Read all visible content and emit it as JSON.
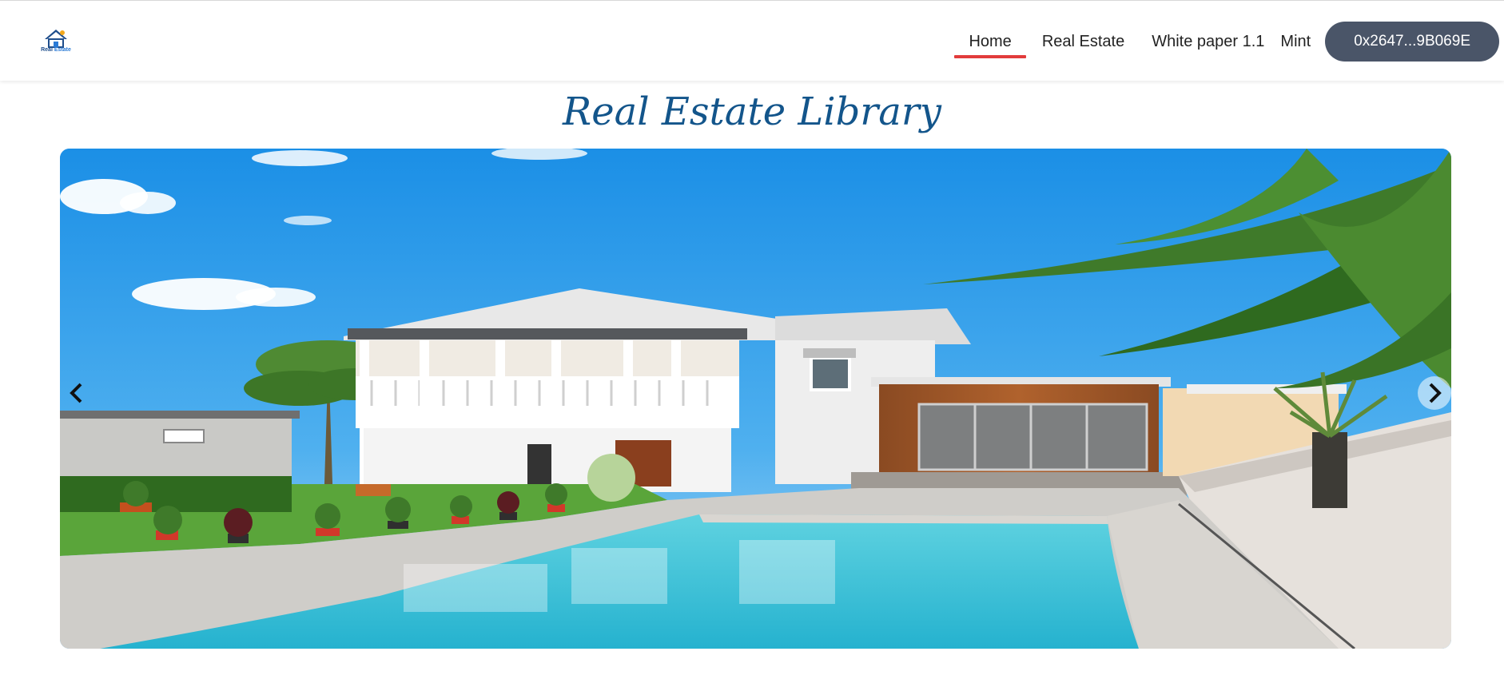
{
  "header": {
    "logo": {
      "icon": "house-logo-icon",
      "text_primary": "Real",
      "text_secondary": "Estate"
    },
    "nav": {
      "home_label": "Home",
      "real_estate_label": "Real Estate",
      "white_paper_label": "White paper 1.1",
      "mint_label": "Mint",
      "active": "Home"
    },
    "wallet": {
      "label": "0x2647...9B069E"
    }
  },
  "main": {
    "title": "Real Estate Library",
    "carousel": {
      "image_alt": "",
      "prev_icon": "chevron-left-icon",
      "next_icon": "chevron-right-icon"
    }
  },
  "colors": {
    "active_underline": "#e23b3b",
    "wallet_button": "#4a5568",
    "title": "#13558b"
  }
}
